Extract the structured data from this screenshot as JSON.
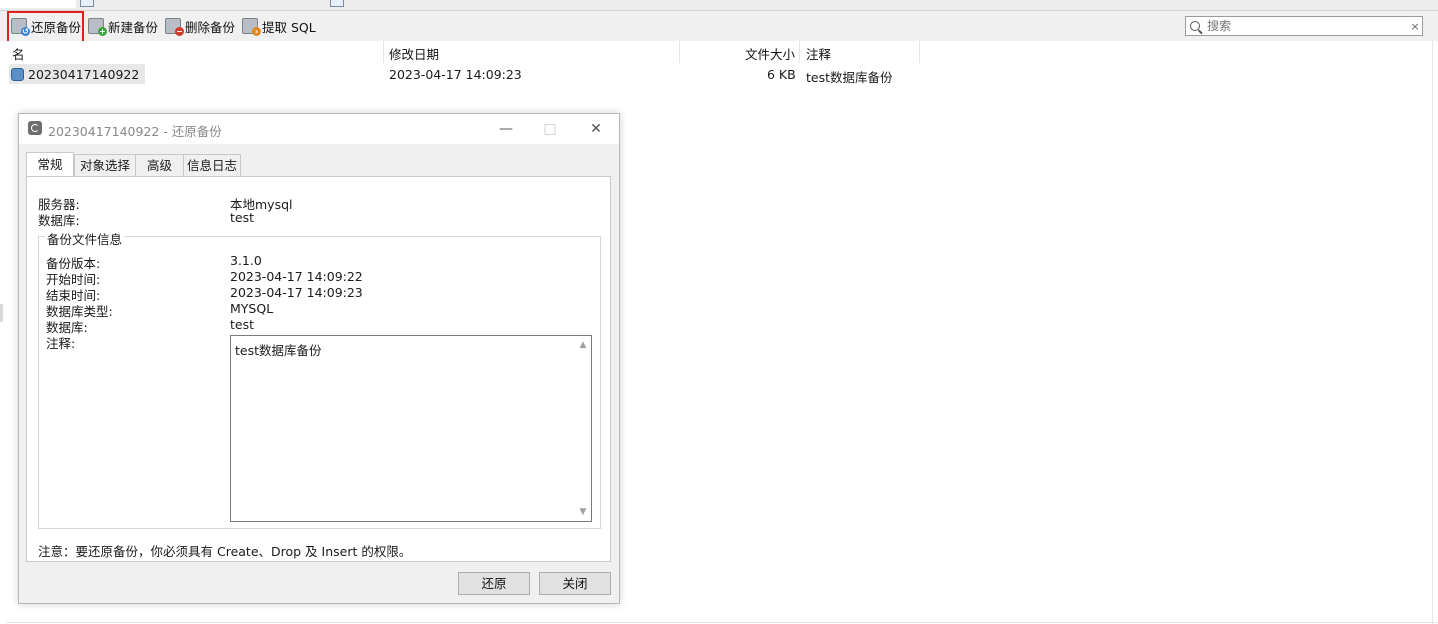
{
  "toolbar": {
    "restore": "还原备份",
    "new": "新建备份",
    "delete": "删除备份",
    "extract": "提取 SQL",
    "search_placeholder": "搜索",
    "clear": "×"
  },
  "table": {
    "headers": {
      "name": "名",
      "modified": "修改日期",
      "size": "文件大小",
      "comment": "注释"
    },
    "rows": [
      {
        "name": "20230417140922",
        "modified": "2023-04-17 14:09:23",
        "size": "6 KB",
        "comment": "test数据库备份"
      }
    ]
  },
  "dialog": {
    "title": "20230417140922 - 还原备份",
    "minimize": "—",
    "maximize": "□",
    "close": "✕",
    "tabs": [
      "常规",
      "对象选择",
      "高级",
      "信息日志"
    ],
    "server_label": "服务器:",
    "server_value": "本地mysql",
    "database_label": "数据库:",
    "database_value": "test",
    "group_title": "备份文件信息",
    "info": {
      "version_label": "备份版本:",
      "version_value": "3.1.0",
      "start_label": "开始时间:",
      "start_value": "2023-04-17 14:09:22",
      "end_label": "结束时间:",
      "end_value": "2023-04-17 14:09:23",
      "dbtype_label": "数据库类型:",
      "dbtype_value": "MYSQL",
      "db_label": "数据库:",
      "db_value": "test",
      "comment_label": "注释:",
      "comment_value": "test数据库备份"
    },
    "note": "注意：要还原备份，你必须具有 Create、Drop 及 Insert 的权限。",
    "restore_button": "还原",
    "close_button": "关闭"
  }
}
